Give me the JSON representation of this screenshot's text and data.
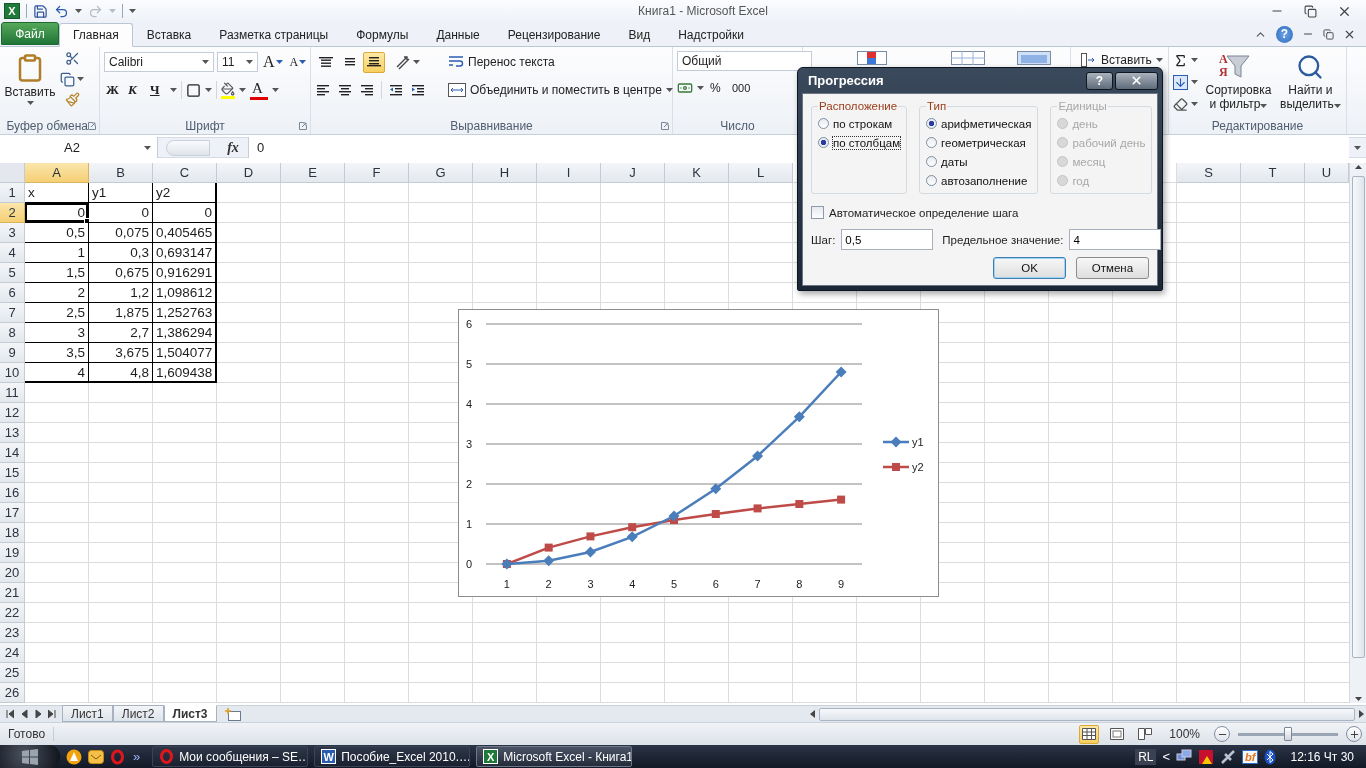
{
  "window": {
    "app_badge": "X",
    "title": "Книга1 - Microsoft Excel",
    "quick_access": [
      {
        "kind": "save",
        "disabled": false
      },
      {
        "kind": "undo",
        "disabled": false
      },
      {
        "kind": "redo",
        "disabled": true
      }
    ]
  },
  "ribbon": {
    "tabs": [
      {
        "label": "Файл",
        "kind": "file",
        "selected": false
      },
      {
        "label": "Главная",
        "kind": "tab",
        "selected": true
      },
      {
        "label": "Вставка",
        "kind": "tab",
        "selected": false
      },
      {
        "label": "Разметка страницы",
        "kind": "tab",
        "selected": false
      },
      {
        "label": "Формулы",
        "kind": "tab",
        "selected": false
      },
      {
        "label": "Данные",
        "kind": "tab",
        "selected": false
      },
      {
        "label": "Рецензирование",
        "kind": "tab",
        "selected": false
      },
      {
        "label": "Вид",
        "kind": "tab",
        "selected": false
      },
      {
        "label": "Надстройки",
        "kind": "tab",
        "selected": false
      }
    ],
    "help": "?",
    "clipboard": {
      "label": "Буфер обмена",
      "paste": "Вставить"
    },
    "font": {
      "label": "Шрифт",
      "name": "Calibri",
      "size": "11",
      "grow": "A",
      "shrink": "A",
      "bold": "Ж",
      "italic": "К",
      "underline": "Ч",
      "font_color": "A"
    },
    "alignment": {
      "label": "Выравнивание",
      "vertical": [
        {
          "kind": "top",
          "selected": false
        },
        {
          "kind": "middle",
          "selected": false
        },
        {
          "kind": "bottom",
          "selected": true
        }
      ],
      "wrap": "Перенос текста",
      "merge": "Объединить и поместить в центре"
    },
    "number": {
      "label": "Число",
      "format": "Общий",
      "percent": "%",
      "thousands": "000"
    },
    "cells": {
      "insert": "Вставить"
    },
    "editing": {
      "label": "Редактирование",
      "sort_letters": "AЯ",
      "sort": "Сортировка и фильтр",
      "find": "Найти и выделить"
    }
  },
  "formula_bar": {
    "name_box": "A2",
    "fx": "fx",
    "value": "0"
  },
  "sheet": {
    "columns": [
      {
        "label": "A",
        "selected": true
      },
      {
        "label": "B",
        "selected": false
      },
      {
        "label": "C",
        "selected": false
      },
      {
        "label": "D",
        "selected": false
      },
      {
        "label": "E",
        "selected": false
      },
      {
        "label": "F",
        "selected": false
      },
      {
        "label": "G",
        "selected": false
      },
      {
        "label": "H",
        "selected": false
      },
      {
        "label": "I",
        "selected": false
      },
      {
        "label": "J",
        "selected": false
      },
      {
        "label": "K",
        "selected": false
      },
      {
        "label": "L",
        "selected": false
      }
    ],
    "columns_right": [
      {
        "label": "S",
        "selected": false
      },
      {
        "label": "T",
        "selected": false
      },
      {
        "label": "U",
        "selected": false
      }
    ],
    "rows": [
      {
        "label": "1",
        "selected": false
      },
      {
        "label": "2",
        "selected": true
      },
      {
        "label": "3",
        "selected": false
      },
      {
        "label": "4",
        "selected": false
      },
      {
        "label": "5",
        "selected": false
      },
      {
        "label": "6",
        "selected": false
      },
      {
        "label": "7",
        "selected": false
      },
      {
        "label": "8",
        "selected": false
      },
      {
        "label": "9",
        "selected": false
      },
      {
        "label": "10",
        "selected": false
      },
      {
        "label": "11",
        "selected": false
      },
      {
        "label": "12",
        "selected": false
      },
      {
        "label": "13",
        "selected": false
      },
      {
        "label": "14",
        "selected": false
      },
      {
        "label": "15",
        "selected": false
      },
      {
        "label": "16",
        "selected": false
      },
      {
        "label": "17",
        "selected": false
      },
      {
        "label": "18",
        "selected": false
      },
      {
        "label": "19",
        "selected": false
      },
      {
        "label": "20",
        "selected": false
      },
      {
        "label": "21",
        "selected": false
      },
      {
        "label": "22",
        "selected": false
      },
      {
        "label": "23",
        "selected": false
      },
      {
        "label": "24",
        "selected": false
      },
      {
        "label": "25",
        "selected": false
      },
      {
        "label": "26",
        "selected": false
      }
    ],
    "header_row": [
      "x",
      "y1",
      "y2"
    ],
    "data": [
      [
        "0",
        "0",
        "0"
      ],
      [
        "0,5",
        "0,075",
        "0,405465"
      ],
      [
        "1",
        "0,3",
        "0,693147"
      ],
      [
        "1,5",
        "0,675",
        "0,916291"
      ],
      [
        "2",
        "1,2",
        "1,098612"
      ],
      [
        "2,5",
        "1,875",
        "1,252763"
      ],
      [
        "3",
        "2,7",
        "1,386294"
      ],
      [
        "3,5",
        "3,675",
        "1,504077"
      ],
      [
        "4",
        "4,8",
        "1,609438"
      ]
    ]
  },
  "chart": {
    "chart_data": {
      "type": "line",
      "categories": [
        "1",
        "2",
        "3",
        "4",
        "5",
        "6",
        "7",
        "8",
        "9"
      ],
      "series": [
        {
          "name": "y1",
          "color": "#4a7ebb",
          "marker": "diamond",
          "values": [
            0,
            0.08,
            0.3,
            0.68,
            1.2,
            1.88,
            2.7,
            3.68,
            4.8
          ]
        },
        {
          "name": "y2",
          "color": "#be4b48",
          "marker": "square",
          "values": [
            0,
            0.41,
            0.69,
            0.92,
            1.1,
            1.25,
            1.39,
            1.5,
            1.61
          ]
        }
      ],
      "ylim": [
        0,
        6
      ],
      "yticks": [
        {
          "value": 0,
          "label": "0"
        },
        {
          "value": 1,
          "label": "1"
        },
        {
          "value": 2,
          "label": "2"
        },
        {
          "value": 3,
          "label": "3"
        },
        {
          "value": 4,
          "label": "4"
        },
        {
          "value": 5,
          "label": "5"
        },
        {
          "value": 6,
          "label": "6"
        }
      ],
      "grid": true,
      "legend": "right"
    }
  },
  "dialog": {
    "title": "Прогрессия",
    "help": "?",
    "placement": {
      "label": "Расположение",
      "disabled": false,
      "options": [
        {
          "label": "по строкам",
          "selected": false,
          "focused": false
        },
        {
          "label": "по столбцам",
          "selected": true,
          "focused": true
        }
      ]
    },
    "type": {
      "label": "Тип",
      "disabled": false,
      "options": [
        {
          "label": "арифметическая",
          "selected": true,
          "focused": false
        },
        {
          "label": "геометрическая",
          "selected": false,
          "focused": false
        },
        {
          "label": "даты",
          "selected": false,
          "focused": false
        },
        {
          "label": "автозаполнение",
          "selected": false,
          "focused": false
        }
      ]
    },
    "units": {
      "label": "Единицы",
      "disabled": true,
      "options": [
        {
          "label": "день",
          "selected": false,
          "focused": false
        },
        {
          "label": "рабочий день",
          "selected": false,
          "focused": false
        },
        {
          "label": "месяц",
          "selected": false,
          "focused": false
        },
        {
          "label": "год",
          "selected": false,
          "focused": false
        }
      ]
    },
    "auto_step": {
      "label": "Автоматическое определение шага",
      "checked": false
    },
    "step": {
      "label": "Шаг:",
      "value": "0,5"
    },
    "limit": {
      "label": "Предельное значение:",
      "value": "4"
    },
    "buttons": [
      {
        "label": "OK",
        "kind": "default"
      },
      {
        "label": "Отмена",
        "kind": "cancel"
      }
    ]
  },
  "sheet_tabs": [
    {
      "label": "Лист1",
      "selected": false
    },
    {
      "label": "Лист2",
      "selected": false
    },
    {
      "label": "Лист3",
      "selected": true
    }
  ],
  "status_bar": {
    "text": "Готово",
    "views": [
      {
        "kind": "normal",
        "selected": true
      },
      {
        "kind": "page_layout",
        "selected": false
      },
      {
        "kind": "page_break",
        "selected": false
      }
    ],
    "zoom": "100%",
    "zoom_slider": {
      "level": 0.5
    }
  },
  "taskbar": {
    "more": "»",
    "tasks": [
      {
        "kind": "opera",
        "label": "Мои сообщения – SE…",
        "selected": false
      },
      {
        "kind": "word",
        "badge": "W",
        "label": "Пособие_Excel 2010.…",
        "selected": false
      },
      {
        "kind": "excel",
        "badge": "X",
        "label": "Microsoft Excel - Книга1",
        "selected": true
      }
    ],
    "language": "RL",
    "tray_more": "<",
    "tray_badge": "bf",
    "clock": "12:16 Чт 30"
  }
}
